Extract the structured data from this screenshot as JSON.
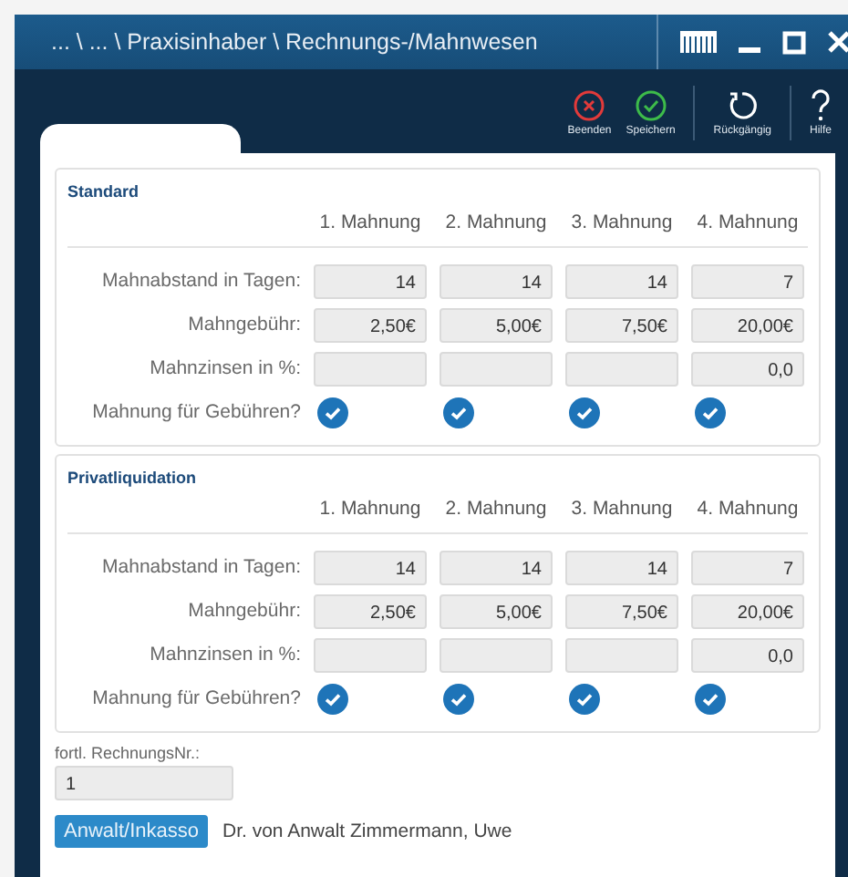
{
  "window": {
    "title": "... \\ ... \\ Praxisinhaber \\ Rechnungs-/Mahnwesen"
  },
  "toolbar": [
    {
      "kind": "close",
      "label": "Beenden"
    },
    {
      "kind": "save",
      "label": "Speichern"
    },
    {
      "kind": "undo",
      "label": "Rückgängig"
    },
    {
      "kind": "help",
      "label": "Hilfe"
    }
  ],
  "groups": [
    {
      "title": "Standard",
      "columns": [
        "1. Mahnung",
        "2. Mahnung",
        "3. Mahnung",
        "4. Mahnung"
      ],
      "rows": [
        {
          "kind": "field",
          "label": "Mahnabstand in Tagen:",
          "cells": [
            {
              "value": "14"
            },
            {
              "value": "14"
            },
            {
              "value": "14"
            },
            {
              "value": "7"
            }
          ]
        },
        {
          "kind": "field",
          "label": "Mahngebühr:",
          "cells": [
            {
              "value": "2,50€"
            },
            {
              "value": "5,00€"
            },
            {
              "value": "7,50€"
            },
            {
              "value": "20,00€"
            }
          ]
        },
        {
          "kind": "field",
          "label": "Mahnzinsen in %:",
          "cells": [
            {},
            {},
            {},
            {
              "value": "0,0"
            }
          ]
        },
        {
          "kind": "checkbox",
          "label": "Mahnung für Gebühren?",
          "checks": [
            {
              "checked": true
            },
            {
              "checked": true
            },
            {
              "checked": true
            },
            {
              "checked": true
            }
          ]
        }
      ]
    },
    {
      "title": "Privatliquidation",
      "columns": [
        "1. Mahnung",
        "2. Mahnung",
        "3. Mahnung",
        "4. Mahnung"
      ],
      "rows": [
        {
          "kind": "field",
          "label": "Mahnabstand in Tagen:",
          "cells": [
            {
              "value": "14"
            },
            {
              "value": "14"
            },
            {
              "value": "14"
            },
            {
              "value": "7"
            }
          ]
        },
        {
          "kind": "field",
          "label": "Mahngebühr:",
          "cells": [
            {
              "value": "2,50€"
            },
            {
              "value": "5,00€"
            },
            {
              "value": "7,50€"
            },
            {
              "value": "20,00€"
            }
          ]
        },
        {
          "kind": "field",
          "label": "Mahnzinsen in %:",
          "cells": [
            {},
            {},
            {},
            {
              "value": "0,0"
            }
          ]
        },
        {
          "kind": "checkbox",
          "label": "Mahnung für Gebühren?",
          "checks": [
            {
              "checked": true
            },
            {
              "checked": true
            },
            {
              "checked": true
            },
            {
              "checked": true
            }
          ]
        }
      ]
    }
  ],
  "invoice_number": {
    "label": "fortl. RechnungsNr.:",
    "value": "1"
  },
  "lawyer": {
    "button": "Anwalt/Inkasso",
    "name": "Dr. von Anwalt Zimmermann, Uwe"
  }
}
